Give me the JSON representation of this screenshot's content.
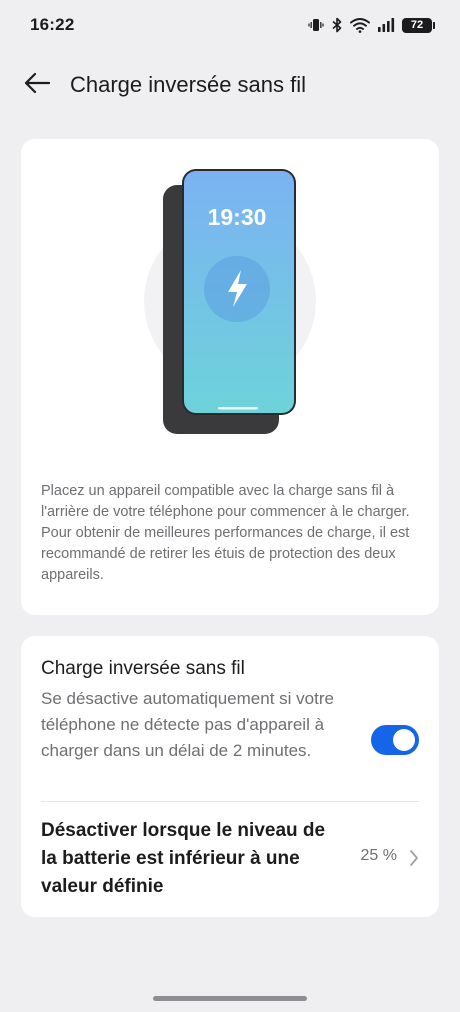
{
  "status_bar": {
    "time": "16:22",
    "battery": "72",
    "icons": [
      "vibrate-icon",
      "bluetooth-icon",
      "wifi-icon",
      "cellular-signal-icon",
      "battery-icon"
    ]
  },
  "header": {
    "back_icon": "back-arrow-icon",
    "title": "Charge inversée sans fil"
  },
  "illustration": {
    "clock": "19:30",
    "icon": "lightning-bolt-icon"
  },
  "description": "Placez un appareil compatible avec la charge sans fil à l'arrière de votre téléphone pour commencer à le charger. Pour obtenir de meilleures performances de charge, il est recommandé de retirer les étuis de protection des deux appareils.",
  "settings": {
    "toggle_row": {
      "title": "Charge inversée sans fil",
      "description": "Se désactive automatiquement si votre téléphone ne détecte pas d'appareil à charger dans un délai de 2 minutes.",
      "enabled": true
    },
    "threshold_row": {
      "title": "Désactiver lorsque le niveau de la batterie est inférieur à une valeur définie",
      "value": "25 %"
    }
  },
  "colors": {
    "background": "#efeff1",
    "card": "#ffffff",
    "accent": "#1565e8",
    "secondary_text": "#6f6f73",
    "screen_gradient_top": "#7bb2f3",
    "screen_gradient_bottom": "#6dd3d9"
  }
}
